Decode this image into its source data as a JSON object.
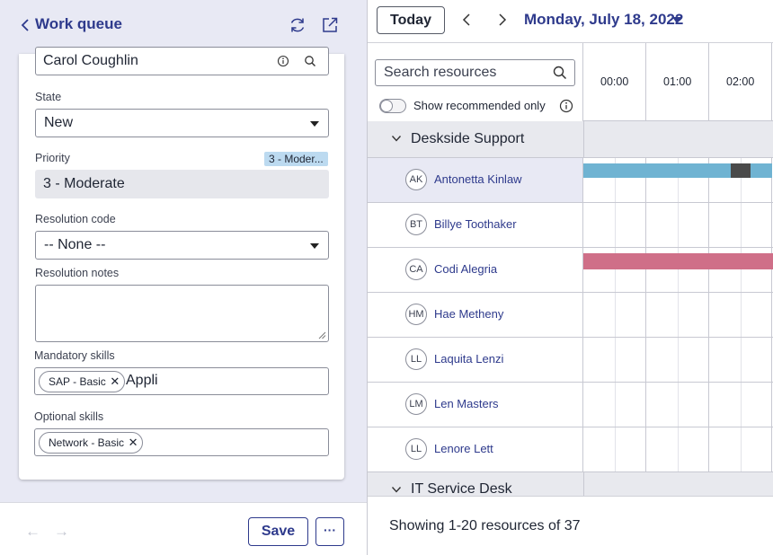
{
  "left_panel": {
    "header": {
      "title": "Work queue",
      "icons": [
        "back-chevron-icon",
        "refresh-icon",
        "open-in-new-window-icon"
      ]
    },
    "form": {
      "assigned_to_value": "Carol Coughlin",
      "assigned_to_icons": [
        "info-icon",
        "search-icon"
      ],
      "state_label": "State",
      "state_value": "New",
      "priority_label": "Priority",
      "priority_badge": "3 - Moder...",
      "priority_value": "3 - Moderate",
      "resolution_code_label": "Resolution code",
      "resolution_code_value": "-- None --",
      "resolution_notes_label": "Resolution notes",
      "resolution_notes_value": "",
      "mandatory_skills_label": "Mandatory skills",
      "mandatory_skills_tags": [
        "SAP - Basic"
      ],
      "mandatory_skills_input": "Appli",
      "optional_skills_label": "Optional skills",
      "optional_skills_tags": [
        "Network - Basic"
      ]
    },
    "footer": {
      "save_label": "Save",
      "more_label": "···"
    }
  },
  "right_panel": {
    "toolbar": {
      "today_label": "Today",
      "date": "Monday, July 18, 2022"
    },
    "search": {
      "placeholder": "Search resources"
    },
    "toggle": {
      "label": "Show recommended only",
      "on": false
    },
    "timeline": {
      "hours": [
        "00:00",
        "01:00",
        "02:00"
      ]
    },
    "groups": [
      {
        "name": "Deskside Support",
        "resources": [
          {
            "initials": "AK",
            "name": "Antonetta Kinlaw",
            "selected": true
          },
          {
            "initials": "BT",
            "name": "Billye Toothaker"
          },
          {
            "initials": "CA",
            "name": "Codi Alegria"
          },
          {
            "initials": "HM",
            "name": "Hae Metheny"
          },
          {
            "initials": "LL",
            "name": "Laquita Lenzi"
          },
          {
            "initials": "LM",
            "name": "Len Masters"
          },
          {
            "initials": "LL",
            "name": "Lenore Lett"
          }
        ]
      },
      {
        "name": "IT Service Desk"
      }
    ],
    "footer_text": "Showing 1-20 resources of 37"
  },
  "colors": {
    "accent": "#2e3a8c",
    "bar_blue": "#6fb3d2",
    "bar_dark": "#4a4a4a",
    "bar_pink": "#cf6f88",
    "priority_badge_bg": "#bcdaf0"
  }
}
